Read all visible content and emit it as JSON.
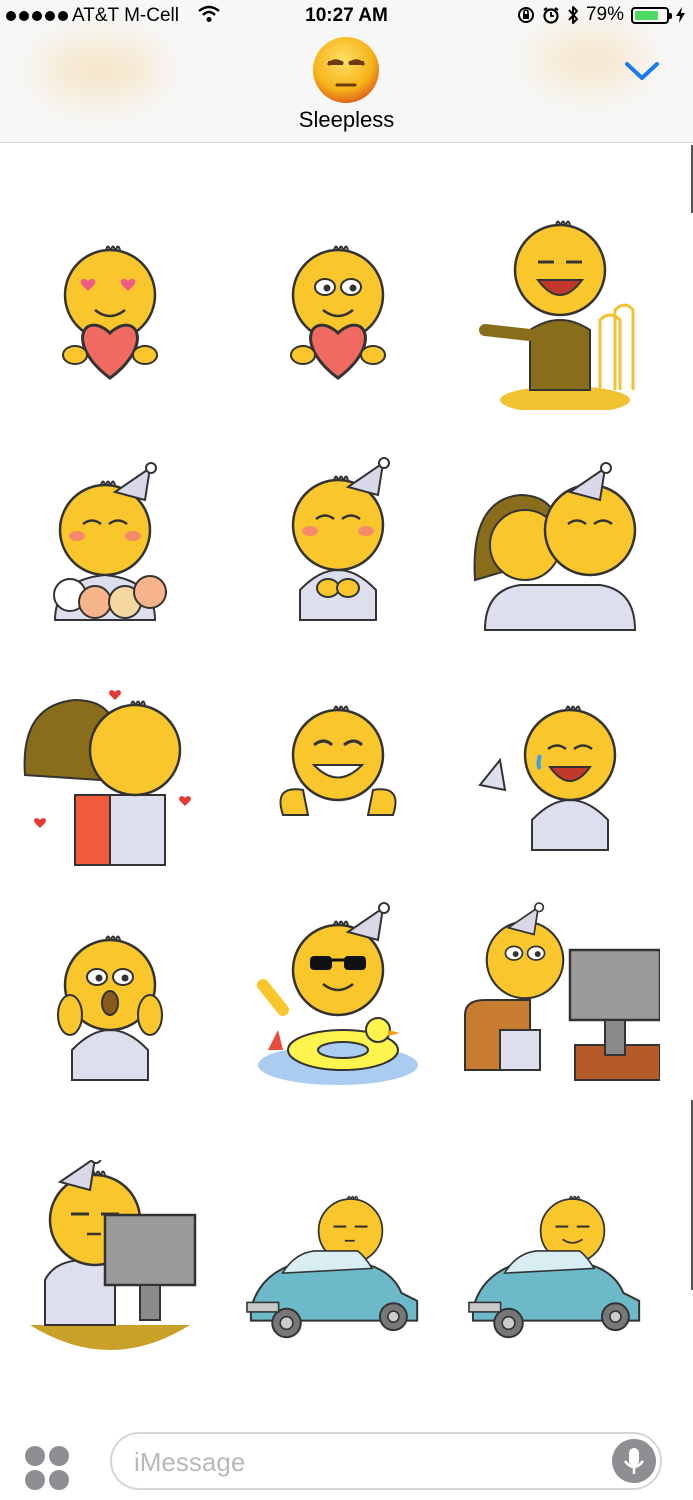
{
  "status_bar": {
    "carrier": "AT&T M-Cell",
    "time": "10:27 AM",
    "battery_percent": "79%",
    "battery_level": 0.79,
    "signal_bars": 5
  },
  "header": {
    "app_title": "Sleepless",
    "avatar_icon": "sleepy-emoji-icon",
    "collapse_icon": "chevron-down-icon"
  },
  "stickers": [
    {
      "name": "sticker-heart-eyes-holding-heart"
    },
    {
      "name": "sticker-smiling-holding-heart"
    },
    {
      "name": "sticker-pointing-in-suit"
    },
    {
      "name": "sticker-blushing-with-cats"
    },
    {
      "name": "sticker-blushing-hands-together"
    },
    {
      "name": "sticker-couple-cheek-to-cheek"
    },
    {
      "name": "sticker-couple-kissing-hearts"
    },
    {
      "name": "sticker-grinning-thumbs"
    },
    {
      "name": "sticker-laughing-tears"
    },
    {
      "name": "sticker-shocked-face"
    },
    {
      "name": "sticker-sunglasses-swim-ring"
    },
    {
      "name": "sticker-watching-monitor-popcorn"
    },
    {
      "name": "sticker-sleepy-at-computer"
    },
    {
      "name": "sticker-driving-blue-car"
    },
    {
      "name": "sticker-driving-blue-car-smile"
    }
  ],
  "input": {
    "placeholder": "iMessage",
    "value": ""
  },
  "colors": {
    "accent": "#1a7cf5",
    "face": "#f9c72b",
    "battery": "#4cd964"
  }
}
